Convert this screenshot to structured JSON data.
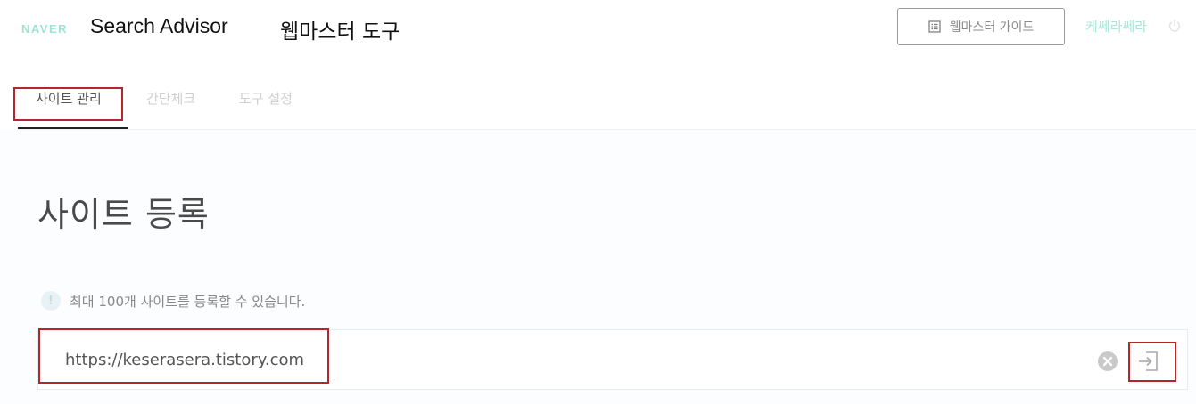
{
  "header": {
    "logo_text": "NAVER",
    "app_title": "Search Advisor",
    "tool_title": "웹마스터 도구",
    "guide_button_label": "웹마스터 가이드",
    "user_name": "케쎄라쎄라",
    "guide_icon": "document-list-icon",
    "power_icon": "power-icon"
  },
  "tabs": [
    {
      "label": "사이트 관리",
      "active": true
    },
    {
      "label": "간단체크",
      "active": false
    },
    {
      "label": "도구 설정",
      "active": false
    }
  ],
  "main": {
    "page_title": "사이트 등록",
    "info_icon_glyph": "!",
    "info_text": "최대 100개 사이트를 등록할 수 있습니다.",
    "url_input_value": "https://keserasera.tistory.com",
    "clear_icon": "clear-circle-icon",
    "submit_icon": "enter-icon"
  },
  "colors": {
    "brand_mint": "#9fe3d2",
    "highlight_red": "#b3262b",
    "active_tab_underline": "#222222"
  }
}
